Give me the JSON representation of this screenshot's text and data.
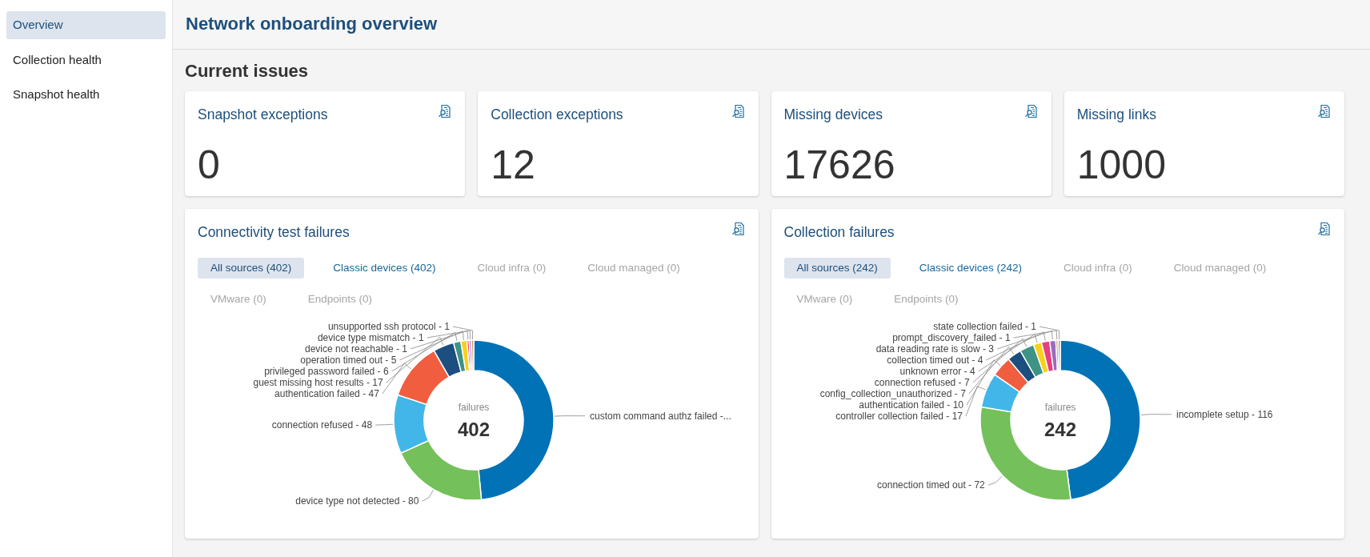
{
  "sidebar": {
    "items": [
      {
        "label": "Overview",
        "selected": true
      },
      {
        "label": "Collection health",
        "selected": false
      },
      {
        "label": "Snapshot health",
        "selected": false
      }
    ]
  },
  "header": {
    "title": "Network onboarding overview"
  },
  "section_title": "Current issues",
  "stat_cards": [
    {
      "title": "Snapshot exceptions",
      "value": "0"
    },
    {
      "title": "Collection exceptions",
      "value": "12"
    },
    {
      "title": "Missing devices",
      "value": "17626"
    },
    {
      "title": "Missing links",
      "value": "1000"
    }
  ],
  "chart_cards": [
    {
      "title": "Connectivity test failures",
      "tabs": [
        {
          "label": "All sources (402)",
          "selected": true,
          "disabled": false
        },
        {
          "label": "Classic devices (402)",
          "selected": false,
          "disabled": false
        },
        {
          "label": "Cloud infra (0)",
          "selected": false,
          "disabled": true
        },
        {
          "label": "Cloud managed (0)",
          "selected": false,
          "disabled": true
        },
        {
          "label": "VMware (0)",
          "selected": false,
          "disabled": true
        },
        {
          "label": "Endpoints (0)",
          "selected": false,
          "disabled": true
        }
      ],
      "center_caption": "failures",
      "total": "402",
      "chart_data": {
        "type": "donut",
        "categories": [
          "custom command authz failed -...",
          "device type not detected - 80",
          "connection refused - 48",
          "authentication failed - 47",
          "guest missing host results - 17",
          "privileged password failed - 6",
          "operation timed out - 5",
          "device not reachable - 1",
          "device type mismatch - 1",
          "unsupported ssh protocol - 1"
        ],
        "values": [
          48.76,
          19.9,
          11.94,
          11.69,
          4.23,
          1.49,
          1.24,
          0.25,
          0.25,
          0.25
        ]
      }
    },
    {
      "title": "Collection failures",
      "tabs": [
        {
          "label": "All sources (242)",
          "selected": true,
          "disabled": false
        },
        {
          "label": "Classic devices (242)",
          "selected": false,
          "disabled": false
        },
        {
          "label": "Cloud infra (0)",
          "selected": false,
          "disabled": true
        },
        {
          "label": "Cloud managed (0)",
          "selected": false,
          "disabled": true
        },
        {
          "label": "VMware (0)",
          "selected": false,
          "disabled": true
        },
        {
          "label": "Endpoints (0)",
          "selected": false,
          "disabled": true
        }
      ],
      "center_caption": "failures",
      "total": "242",
      "chart_data": {
        "type": "donut",
        "categories": [
          "incomplete setup - 116",
          "connection timed out - 72",
          "controller collection failed - 17",
          "authentication failed - 10",
          "config_collection_unauthorized - 7",
          "connection refused - 7",
          "unknown error - 4",
          "collection timed out - 4",
          "data reading rate is slow - 3",
          "prompt_discovery_failed - 1",
          "state collection failed - 1"
        ],
        "values": [
          47.96,
          29.75,
          7.02,
          4.13,
          2.89,
          2.89,
          1.65,
          1.65,
          1.24,
          0.41,
          0.41
        ]
      }
    }
  ]
}
